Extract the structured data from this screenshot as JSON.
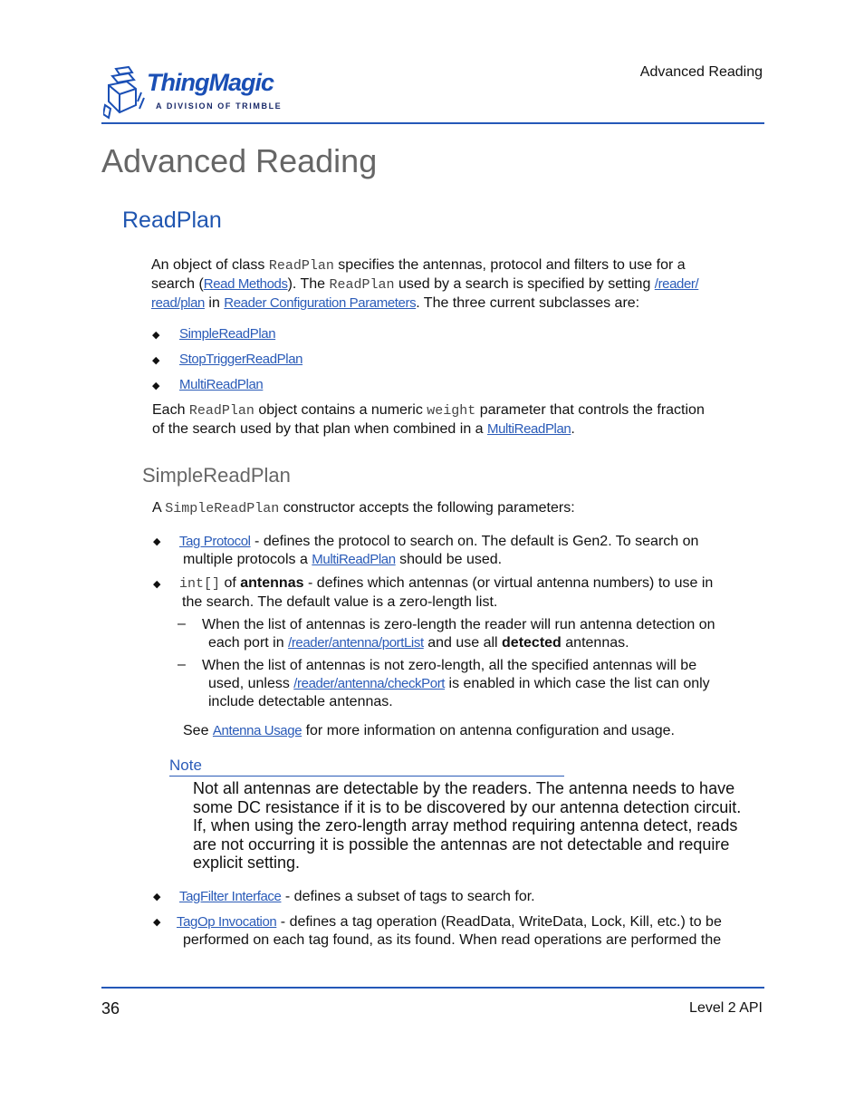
{
  "header": {
    "logo": {
      "brand": "ThingMagic",
      "tagline": "A DIVISION OF TRIMBLE",
      "icon": "stacked-cube-logo-icon"
    },
    "running_title": "Advanced Reading"
  },
  "title": "Advanced Reading",
  "section": {
    "heading": "ReadPlan",
    "intro": {
      "t1": "An object of class ",
      "c1": "ReadPlan",
      "t2": " specifies the antennas, protocol and filters to use for a",
      "t3": "search (",
      "l1": "Read Methods",
      "t4": "). The ",
      "c2": "ReadPlan",
      "t5": " used by a search is specified by setting ",
      "l2a": "/reader/",
      "l2b": "read/plan",
      "t6": " in ",
      "l3": "Reader Configuration Parameters",
      "t7": ". The three current subclasses are:"
    },
    "subclasses": [
      "SimpleReadPlan",
      "StopTriggerReadPlan",
      "MultiReadPlan"
    ],
    "weight_para": {
      "t1": "Each ",
      "c1": "ReadPlan",
      "t2": " object contains a numeric ",
      "c2": "weight",
      "t3": " parameter that controls the fraction",
      "t4": "of the search used by that plan when combined in a ",
      "l1": "MultiReadPlan",
      "t5": "."
    }
  },
  "subsection": {
    "heading": "SimpleReadPlan",
    "intro": {
      "t1": "A ",
      "c1": "SimpleReadPlan",
      "t2": " constructor accepts the following parameters:"
    },
    "param1": {
      "link": "Tag Protocol",
      "t1": " - defines the protocol to search on. The default is Gen2. To search on",
      "t2": "multiple protocols a ",
      "link2": "MultiReadPlan",
      "t3": " should be used."
    },
    "param2": {
      "code": "int[]",
      "t1": " of ",
      "bold": "antennas",
      "t2": " - defines which antennas (or virtual antenna numbers) to use in",
      "t3": "the search. The default value is a zero-length list."
    },
    "sub1": {
      "dash": "–",
      "t1": "When the list of antennas is zero-length the reader will run antenna detection on",
      "t2": "each port in ",
      "link": "/reader/antenna/portList",
      "t3": " and use all ",
      "bold": "detected",
      "t4": " antennas."
    },
    "sub2": {
      "dash": "–",
      "t1": "When the list of antennas is not zero-length, all the specified antennas will be",
      "t2": "used, unless ",
      "link": "/reader/antenna/checkPort",
      "t3": " is enabled in which case the list can only",
      "t4": "include detectable antennas."
    },
    "see": {
      "t1": "See ",
      "link": "Antenna Usage",
      "t2": " for more information on antenna configuration and usage."
    },
    "note": {
      "label": "Note",
      "lines": [
        "Not all antennas are detectable by the readers. The antenna needs to have",
        "some DC resistance if it is to be discovered by our antenna detection circuit.",
        "If, when using the zero-length array method requiring antenna detect, reads",
        "are not occurring it is possible the antennas are not detectable and require",
        "explicit setting."
      ]
    },
    "param3": {
      "link": "TagFilter Interface",
      "t1": " - defines a subset of tags to search for."
    },
    "param4": {
      "link": "TagOp Invocation",
      "t1": " - defines a tag operation (ReadData, WriteData, Lock, Kill, etc.) to be",
      "t2": "performed on each tag found, as its found. When read operations are performed the"
    }
  },
  "footer": {
    "page_number": "36",
    "section": "Level 2 API"
  },
  "colors": {
    "accent": "#2458b8",
    "link": "#2a5bb8",
    "heading_gray": "#666666"
  }
}
